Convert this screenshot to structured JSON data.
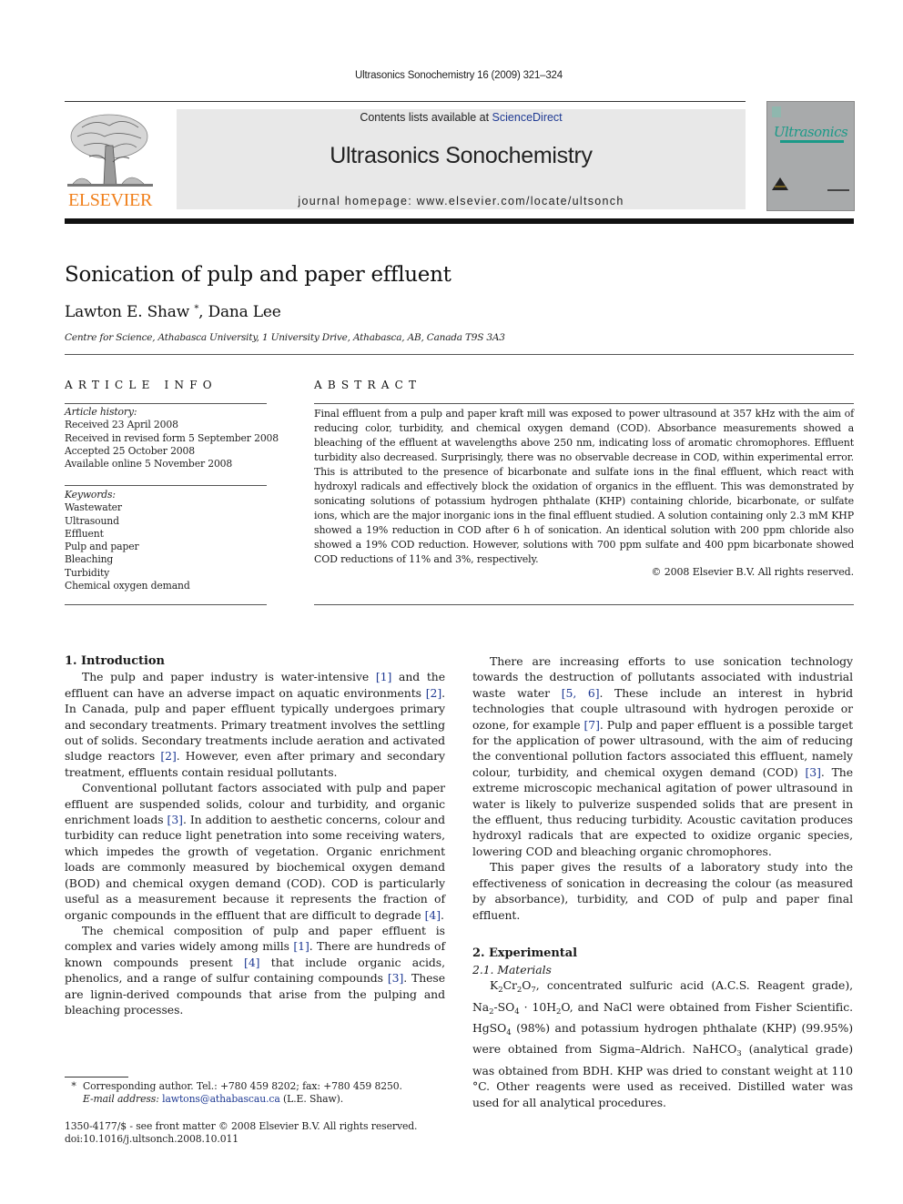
{
  "header": {
    "citation": "Ultrasonics Sonochemistry 16 (2009) 321–324",
    "publisher_logo": "ELSEVIER",
    "contents_prefix": "Contents lists available at ",
    "contents_link": "ScienceDirect",
    "journal_title": "Ultrasonics Sonochemistry",
    "homepage": "journal homepage: www.elsevier.com/locate/ultsonch",
    "cover_title": "Ultrasonics",
    "colors": {
      "elsevier_orange": "#f07f1a",
      "link_blue": "#1f3a93",
      "cover_teal": "#1a9a88",
      "banner_gray": "#e8e8e8"
    }
  },
  "article": {
    "title": "Sonication of pulp and paper effluent",
    "author1": "Lawton E. Shaw",
    "author1_mark": "*",
    "author_sep": ", ",
    "author2": "Dana Lee",
    "affiliation": "Centre for Science, Athabasca University, 1 University Drive, Athabasca, AB, Canada T9S 3A3"
  },
  "article_info": {
    "heading": "ARTICLE INFO",
    "history_label": "Article history:",
    "history": [
      "Received 23 April 2008",
      "Received in revised form 5 September 2008",
      "Accepted 25 October 2008",
      "Available online 5 November 2008"
    ],
    "keywords_label": "Keywords:",
    "keywords": [
      "Wastewater",
      "Ultrasound",
      "Effluent",
      "Pulp and paper",
      "Bleaching",
      "Turbidity",
      "Chemical oxygen demand"
    ]
  },
  "abstract": {
    "heading": "ABSTRACT",
    "text": "Final effluent from a pulp and paper kraft mill was exposed to power ultrasound at 357 kHz with the aim of reducing color, turbidity, and chemical oxygen demand (COD). Absorbance measurements showed a bleaching of the effluent at wavelengths above 250 nm, indicating loss of aromatic chromophores. Effluent turbidity also decreased. Surprisingly, there was no observable decrease in COD, within experimental error. This is attributed to the presence of bicarbonate and sulfate ions in the final effluent, which react with hydroxyl radicals and effectively block the oxidation of organics in the effluent. This was demonstrated by sonicating solutions of potassium hydrogen phthalate (KHP) containing chloride, bicarbonate, or sulfate ions, which are the major inorganic ions in the final effluent studied. A solution containing only 2.3 mM KHP showed a 19% reduction in COD after 6 h of sonication. An identical solution with 200 ppm chloride also showed a 19% COD reduction. However, solutions with 700 ppm sulfate and 400 ppm bicarbonate showed COD reductions of 11% and 3%, respectively.",
    "copyright": "© 2008 Elsevier B.V. All rights reserved."
  },
  "body": {
    "intro_heading": "1. Introduction",
    "intro_p1": [
      "The pulp and paper industry is water-intensive ",
      "[1]",
      " and the effluent can have an adverse impact on aquatic environments ",
      "[2]",
      ". In Canada, pulp and paper effluent typically undergoes primary and secondary treatments. Primary treatment involves the settling out of solids. Secondary treatments include aeration and activated sludge reactors ",
      "[2]",
      ". However, even after primary and secondary treatment, effluents contain residual pollutants."
    ],
    "intro_p2": [
      "Conventional pollutant factors associated with pulp and paper effluent are suspended solids, colour and turbidity, and organic enrichment loads ",
      "[3]",
      ". In addition to aesthetic concerns, colour and turbidity can reduce light penetration into some receiving waters, which impedes the growth of vegetation. Organic enrichment loads are commonly measured by biochemical oxygen demand (BOD) and chemical oxygen demand (COD). COD is particularly useful as a measurement because it represents the fraction of organic compounds in the effluent that are difficult to degrade ",
      "[4]",
      "."
    ],
    "intro_p3": [
      "The chemical composition of pulp and paper effluent is complex and varies widely among mills ",
      "[1]",
      ". There are hundreds of known compounds present ",
      "[4]",
      " that include organic acids, phenolics, and a range of sulfur containing compounds ",
      "[3]",
      ". These are lignin-derived compounds that arise from the pulping and bleaching processes."
    ],
    "intro_p4": [
      "There are increasing efforts to use sonication technology towards the destruction of pollutants associated with industrial waste water ",
      "[5, 6]",
      ". These include an interest in hybrid technologies that couple ultrasound with hydrogen peroxide or ozone, for example ",
      "[7]",
      ". Pulp and paper effluent is a possible target for the application of power ultrasound, with the aim of reducing the conventional pollution factors associated this effluent, namely colour, turbidity, and chemical oxygen demand (COD) ",
      "[3]",
      ". The extreme microscopic mechanical agitation of power ultrasound in water is likely to pulverize suspended solids that are present in the effluent, thus reducing turbidity. Acoustic cavitation produces hydroxyl radicals that are expected to oxidize organic species, lowering COD and bleaching organic chromophores."
    ],
    "intro_p5": "This paper gives the results of a laboratory study into the effectiveness of sonication in decreasing the colour (as measured by absorbance), turbidity, and COD of pulp and paper final effluent.",
    "exp_heading": "2. Experimental",
    "materials_heading": "2.1. Materials",
    "materials": {
      "k2cr2o7": [
        "K",
        "2",
        "Cr",
        "2",
        "O",
        "7"
      ],
      "t1": ", concentrated sulfuric acid (A.C.S. Reagent grade), Na",
      "s1": "2",
      "t2": "SO",
      "s2": "4",
      "t3": " · 10H",
      "s3": "2",
      "t4": "O, and NaCl were obtained from Fisher Scientific. HgSO",
      "s4": "4",
      "t5": " (98%) and potassium hydrogen phthalate (KHP) (99.95%) were obtained from Sigma–Aldrich. NaHCO",
      "s5": "3",
      "t6": " (analytical grade) was obtained from BDH. KHP was dried to constant weight at 110 °C. Other reagents were used as received. Distilled water was used for all analytical procedures."
    }
  },
  "footnote": {
    "mark": "*",
    "line1": "Corresponding author. Tel.: +780 459 8202; fax: +780 459 8250.",
    "email_label": "E-mail address: ",
    "email": "lawtons@athabascau.ca",
    "email_suffix": " (L.E. Shaw).",
    "issn": "1350-4177/$ - see front matter © 2008 Elsevier B.V. All rights reserved.",
    "doi": "doi:10.1016/j.ultsonch.2008.10.011"
  }
}
